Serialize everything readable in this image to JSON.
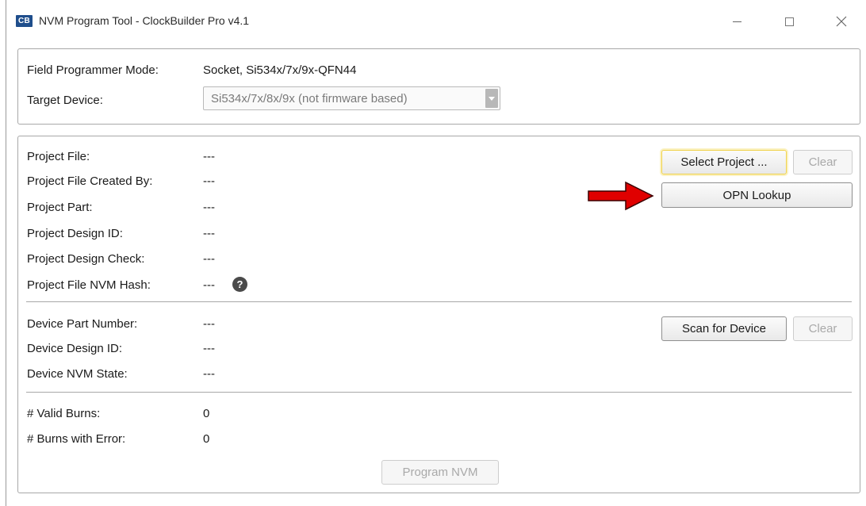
{
  "window": {
    "logo": "CB",
    "title": "NVM Program Tool - ClockBuilder Pro v4.1"
  },
  "mode_panel": {
    "field_programmer_label": "Field Programmer Mode:",
    "field_programmer_value": "Socket, Si534x/7x/9x-QFN44",
    "target_device_label": "Target Device:",
    "target_device_selected": "Si534x/7x/8x/9x (not firmware based)"
  },
  "project": {
    "rows": [
      {
        "label": "Project File:",
        "value": "---"
      },
      {
        "label": "Project File Created By:",
        "value": "---"
      },
      {
        "label": "Project Part:",
        "value": "---"
      },
      {
        "label": "Project Design ID:",
        "value": "---"
      },
      {
        "label": "Project Design Check:",
        "value": "---"
      },
      {
        "label": "Project File NVM Hash:",
        "value": "---"
      }
    ],
    "help_icon": "?",
    "select_button": "Select Project ...",
    "clear_button": "Clear",
    "opn_button": "OPN Lookup"
  },
  "device": {
    "rows": [
      {
        "label": "Device Part Number:",
        "value": "---"
      },
      {
        "label": "Device Design ID:",
        "value": "---"
      },
      {
        "label": "Device NVM State:",
        "value": "---"
      }
    ],
    "scan_button": "Scan for Device",
    "clear_button": "Clear"
  },
  "burns": {
    "rows": [
      {
        "label": "# Valid Burns:",
        "value": "0"
      },
      {
        "label": "# Burns with Error:",
        "value": "0"
      }
    ],
    "program_button": "Program NVM"
  },
  "annotation": {
    "arrow_color": "#e00000",
    "arrow_icon": "red-arrow-right"
  }
}
